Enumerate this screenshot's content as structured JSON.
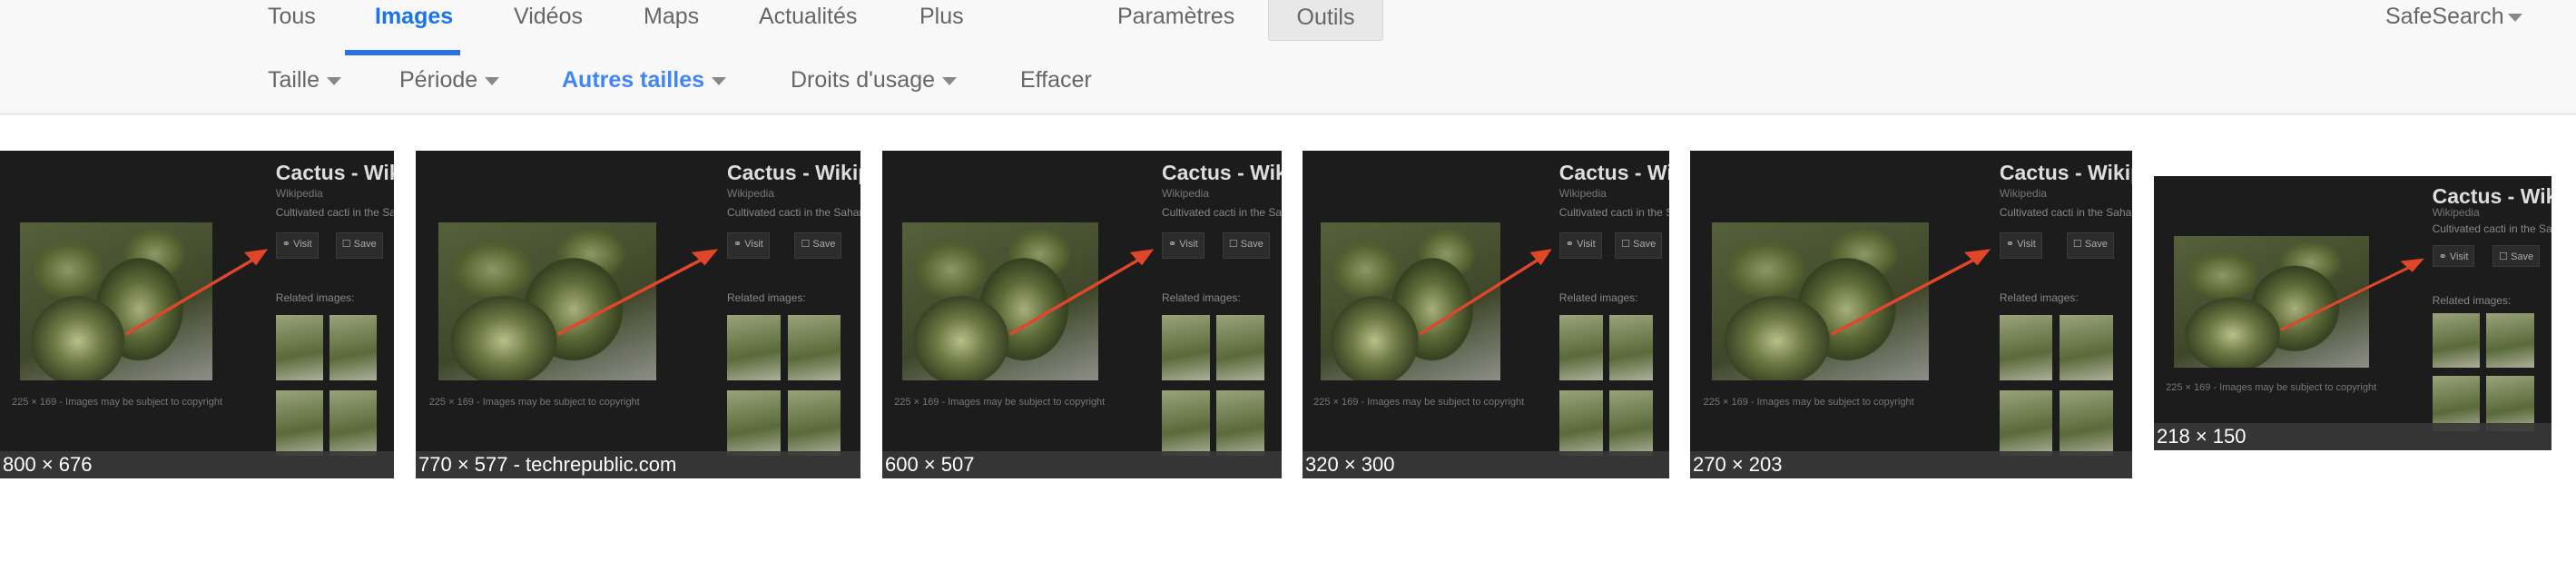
{
  "nav": {
    "tabs": [
      {
        "label": "Tous",
        "active": false
      },
      {
        "label": "Images",
        "active": true
      },
      {
        "label": "Vidéos",
        "active": false
      },
      {
        "label": "Maps",
        "active": false
      },
      {
        "label": "Actualités",
        "active": false
      },
      {
        "label": "Plus",
        "active": false
      }
    ],
    "settings_label": "Paramètres",
    "tools_label": "Outils",
    "safesearch_label": "SafeSearch",
    "accent_color": "#1a73e8"
  },
  "filters": {
    "items": [
      {
        "label": "Taille",
        "dropdown": true,
        "active": false
      },
      {
        "label": "Période",
        "dropdown": true,
        "active": false
      },
      {
        "label": "Autres tailles",
        "dropdown": true,
        "active": true
      },
      {
        "label": "Droits d'usage",
        "dropdown": true,
        "active": false
      }
    ],
    "clear_label": "Effacer"
  },
  "thumbnail_content": {
    "title": "Cactus - Wikipedia",
    "source": "Wikipedia",
    "description": "Cultivated cacti in the Sahara",
    "visit_label": "Visit",
    "save_label": "Save",
    "related_label": "Related images:",
    "copyright": "225 × 169 - Images may be subject to copyright"
  },
  "results": [
    {
      "caption": "800 × 676"
    },
    {
      "caption": "770 × 577 - techrepublic.com"
    },
    {
      "caption": "600 × 507"
    },
    {
      "caption": "320 × 300"
    },
    {
      "caption": "270 × 203"
    },
    {
      "caption": "218 × 150"
    }
  ]
}
